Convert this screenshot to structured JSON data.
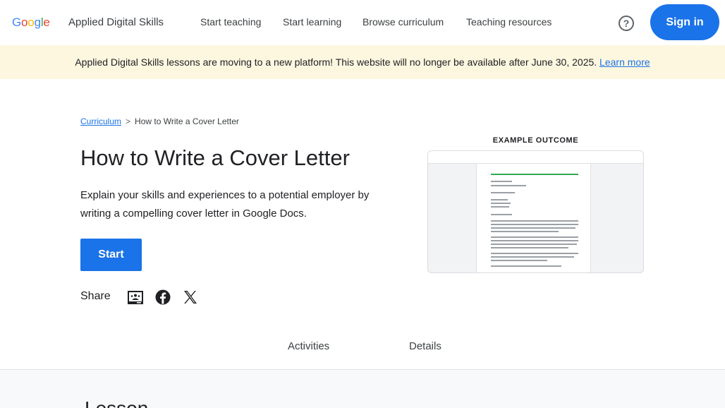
{
  "header": {
    "logo_letters": [
      {
        "ch": "G",
        "color": "#4285F4"
      },
      {
        "ch": "o",
        "color": "#EA4335"
      },
      {
        "ch": "o",
        "color": "#FBBC05"
      },
      {
        "ch": "g",
        "color": "#4285F4"
      },
      {
        "ch": "l",
        "color": "#34A853"
      },
      {
        "ch": "e",
        "color": "#EA4335"
      }
    ],
    "app_name": "Applied Digital Skills",
    "nav": [
      "Start teaching",
      "Start learning",
      "Browse curriculum",
      "Teaching resources"
    ],
    "help_glyph": "?",
    "sign_in": "Sign in"
  },
  "banner": {
    "text": "Applied Digital Skills lessons are moving to a new platform! This website will no longer be available after June 30, 2025.",
    "link": "Learn more"
  },
  "breadcrumb": {
    "root": "Curriculum",
    "separator": ">",
    "current": "How to Write a Cover Letter"
  },
  "lesson": {
    "title": "How to Write a Cover Letter",
    "description": "Explain your skills and experiences to a potential employer by writing a compelling cover letter in Google Docs.",
    "start_label": "Start",
    "share_label": "Share",
    "share_icons": [
      "google-classroom-icon",
      "facebook-icon",
      "x-twitter-icon"
    ]
  },
  "outcome": {
    "label": "EXAMPLE OUTCOME"
  },
  "tabs": [
    "Activities",
    "Details"
  ],
  "section_heading": "Lesson",
  "colors": {
    "accent": "#1a73e8",
    "banner_bg": "#fef7e0"
  }
}
